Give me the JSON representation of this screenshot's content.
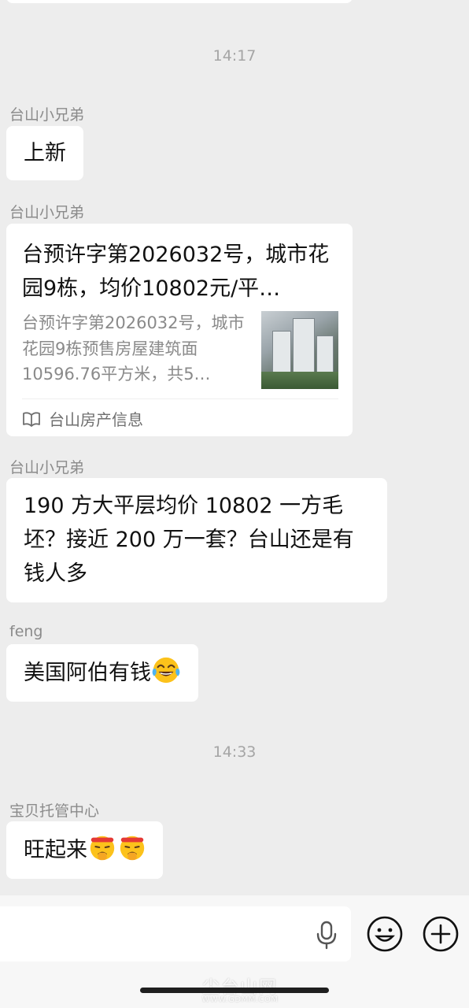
{
  "timestamps": [
    "14:17",
    "14:33"
  ],
  "messages": [
    {
      "sender": "台山小兄弟",
      "text": "上新"
    },
    {
      "sender": "台山小兄弟",
      "card": {
        "title": "台预许字第2026032号，城市花园9栋，均价10802元/平…",
        "description": "台预许字第2026032号，城市花园9栋预售房屋建筑面10596.76平方米，共5…",
        "source": "台山房产信息",
        "source_icon": "book-open-icon"
      }
    },
    {
      "sender": "台山小兄弟",
      "text": "190 方大平层均价 10802 一方毛坯？接近 200 万一套？台山还是有钱人多"
    },
    {
      "sender": "feng",
      "text": "美国阿伯有钱",
      "emoji": "tears-of-joy-emoji"
    },
    {
      "sender": "宝贝托管中心",
      "text": "旺起来",
      "emoji": "rich-face-emoji"
    }
  ],
  "input_bar": {
    "mic_icon": "microphone-icon",
    "emoji_icon": "smiley-icon",
    "plus_icon": "plus-circle-icon"
  },
  "watermark": {
    "text": "尘台山网",
    "sub": "WWW.GDMM.COM"
  },
  "colors": {
    "background": "#ededed",
    "bubble": "#ffffff",
    "sender_text": "#8b8b8b",
    "timestamp_text": "#a5a5a5"
  }
}
